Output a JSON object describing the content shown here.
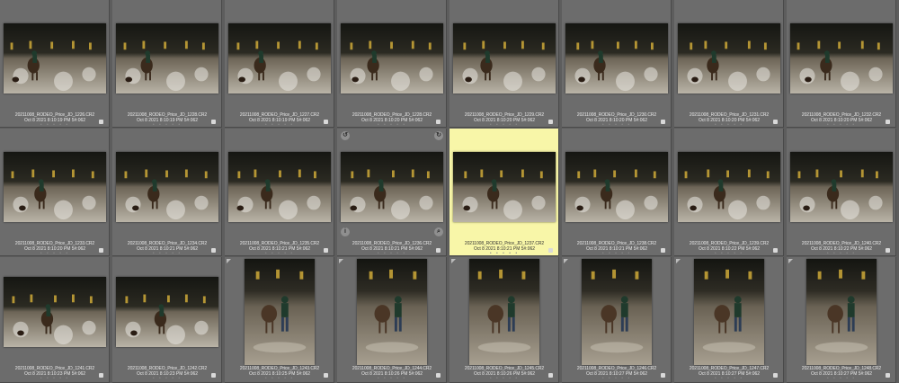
{
  "grid": {
    "rows": [
      [
        {
          "filename": "20211008_RODEO_Price_JD_1226.CR2",
          "meta": "Oct 8 2021 8:10:19 PM 5#:062"
        },
        {
          "filename": "20211008_RODEO_Price_JD_1228.CR2",
          "meta": "Oct 8 2021 8:10:19 PM 5#:062"
        },
        {
          "filename": "20211008_RODEO_Price_JD_1227.CR2",
          "meta": "Oct 8 2021 8:10:19 PM 5#:062"
        },
        {
          "filename": "20211008_RODEO_Price_JD_1228.CR2",
          "meta": "Oct 8 2021 8:10:20 PM 5#:062"
        },
        {
          "filename": "20211008_RODEO_Price_JD_1229.CR2",
          "meta": "Oct 8 2021 8:10:20 PM 5#:062"
        },
        {
          "filename": "20211008_RODEO_Price_JD_1230.CR2",
          "meta": "Oct 8 2021 8:10:20 PM 5#:062"
        },
        {
          "filename": "20211008_RODEO_Price_JD_1231.CR2",
          "meta": "Oct 8 2021 8:10:20 PM 5#:062"
        },
        {
          "filename": "20211008_RODEO_Price_JD_1232.CR2",
          "meta": "Oct 8 2021 8:10:20 PM 5#:062"
        }
      ],
      [
        {
          "filename": "20211008_RODEO_Price_JD_1233.CR2",
          "meta": "Oct 8 2021 8:10:20 PM 5#:062"
        },
        {
          "filename": "20211008_RODEO_Price_JD_1234.CR2",
          "meta": "Oct 8 2021 8:10:21 PM 5#:062"
        },
        {
          "filename": "20211008_RODEO_Price_JD_1235.CR2",
          "meta": "Oct 8 2021 8:10:21 PM 5#:062"
        },
        {
          "filename": "20211008_RODEO_Price_JD_1236.CR2",
          "meta": "Oct 8 2021 8:10:21 PM 5#:062"
        },
        {
          "filename": "20211008_RODEO_Price_JD_1237.CR2",
          "meta": "Oct 8 2021 8:10:21 PM 5#:062"
        },
        {
          "filename": "20211008_RODEO_Price_JD_1238.CR2",
          "meta": "Oct 8 2021 8:10:21 PM 5#:062"
        },
        {
          "filename": "20211008_RODEO_Price_JD_1239.CR2",
          "meta": "Oct 8 2021 8:10:22 PM 5#:062"
        },
        {
          "filename": "20211008_RODEO_Price_JD_1240.CR2",
          "meta": "Oct 8 2021 8:10:22 PM 5#:062"
        }
      ],
      [
        {
          "filename": "20211008_RODEO_Price_JD_1241.CR2",
          "meta": "Oct 8 2021 8:10:23 PM 5#:062"
        },
        {
          "filename": "20211008_RODEO_Price_JD_1242.CR2",
          "meta": "Oct 8 2021 8:10:23 PM 5#:062"
        },
        {
          "filename": "20211008_RODEO_Price_JD_1243.CR2",
          "meta": "Oct 8 2021 8:10:25 PM 5#:062"
        },
        {
          "filename": "20211008_RODEO_Price_JD_1244.CR2",
          "meta": "Oct 8 2021 8:10:26 PM 5#:062"
        },
        {
          "filename": "20211008_RODEO_Price_JD_1245.CR2",
          "meta": "Oct 8 2021 8:10:26 PM 5#:062"
        },
        {
          "filename": "20211008_RODEO_Price_JD_1246.CR2",
          "meta": "Oct 8 2021 8:10:27 PM 5#:062"
        },
        {
          "filename": "20211008_RODEO_Price_JD_1247.CR2",
          "meta": "Oct 8 2021 8:10:27 PM 5#:062"
        },
        {
          "filename": "20211008_RODEO_Price_JD_1248.CR2",
          "meta": "Oct 8 2021 8:10:27 PM 5#:062"
        }
      ]
    ],
    "selected": {
      "row": 1,
      "col": 4
    },
    "rating_dots": "• • • • •",
    "icons": {
      "rotate_left": "rotate-left-icon",
      "rotate_right": "rotate-right-icon",
      "info": "info-icon",
      "zoom": "zoom-icon"
    },
    "colors": {
      "background": "#5d5d5d",
      "cell": "#6c6c6c",
      "selected_cell": "#f8f6a8",
      "text": "#e9e9e9"
    }
  }
}
